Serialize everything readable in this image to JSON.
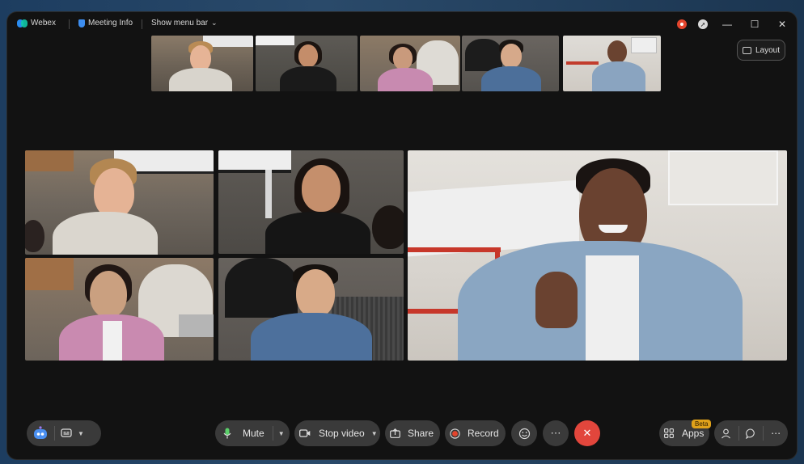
{
  "titlebar": {
    "app_name": "Webex",
    "meeting_info": "Meeting Info",
    "show_menu_bar": "Show menu bar"
  },
  "layout_button": {
    "label": "Layout"
  },
  "controls": {
    "mute": "Mute",
    "stop_video": "Stop video",
    "share": "Share",
    "record": "Record",
    "apps": "Apps",
    "apps_badge": "Beta"
  },
  "colors": {
    "end_call": "#e2463c",
    "record_dot": "#e3452d",
    "mute_mic": "#5bcf6a",
    "beta_badge": "#e0a21a"
  },
  "icons": {
    "assistant": "ai-assistant-icon",
    "captions": "captions-icon",
    "mic": "microphone-icon",
    "camera": "video-camera-icon",
    "share": "share-icon",
    "record": "record-icon",
    "reactions": "emoji-icon",
    "more": "more-icon",
    "end": "close-icon",
    "apps": "apps-grid-icon",
    "participants": "participants-icon",
    "chat": "chat-icon"
  }
}
